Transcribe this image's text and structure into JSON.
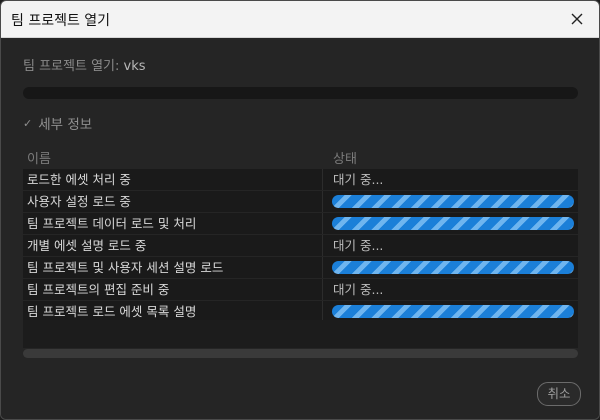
{
  "window": {
    "title": "팀 프로젝트 열기"
  },
  "header": {
    "prefix": "팀 프로젝트 열기:",
    "project_name": "vks"
  },
  "overall_progress": 0.0,
  "details": {
    "toggle_label": "세부 정보",
    "toggle_icon": "check-chevron-icon"
  },
  "table": {
    "columns": {
      "name": "이름",
      "status": "상태"
    },
    "rows": [
      {
        "name": "로드한 에셋 처리 중",
        "status_text": "대기 중...",
        "in_progress": false
      },
      {
        "name": "사용자 설정 로드 중",
        "status_text": "",
        "in_progress": true
      },
      {
        "name": "팀 프로젝트 데이터 로드 및 처리",
        "status_text": "",
        "in_progress": true
      },
      {
        "name": "개별 에셋 설명 로드 중",
        "status_text": "대기 중...",
        "in_progress": false
      },
      {
        "name": "팀 프로젝트 및 사용자 세션 설명 로드",
        "status_text": "",
        "in_progress": true
      },
      {
        "name": "팀 프로젝트의 편집 준비 중",
        "status_text": "대기 중...",
        "in_progress": false
      },
      {
        "name": "팀 프로젝트 로드 에셋 목록 설명",
        "status_text": "",
        "in_progress": true
      }
    ]
  },
  "buttons": {
    "cancel": "취소"
  },
  "colors": {
    "progress_primary": "#1b7fd8",
    "progress_stripe": "#6fb5ef",
    "background": "#252525"
  }
}
